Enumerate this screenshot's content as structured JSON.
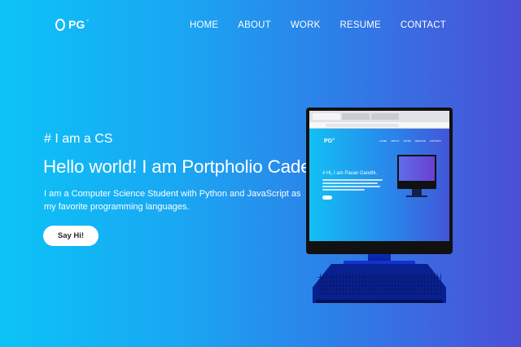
{
  "header": {
    "logo_text": "PG",
    "logo_mark": "°",
    "nav": [
      "HOME",
      "ABOUT",
      "WORK",
      "RESUME",
      "CONTACT"
    ]
  },
  "hero": {
    "eyebrow": "# I am a CS",
    "headline": "Hello world! I am Portpholio Caden",
    "lead": "I am a Computer Science Student with Python and JavaScript as my favorite programming languages.",
    "cta_label": "Say Hi!"
  },
  "illustration": {
    "screen_logo": "PG°",
    "screen_nav": [
      "HOME",
      "ABOUT",
      "WORK",
      "RESUME",
      "CONTACT"
    ],
    "screen_title": "# Hi, I am Pavan Gandhi."
  },
  "colors": {
    "gradient_start": "#0cc3f7",
    "gradient_end": "#4b4fd6",
    "button_bg": "#ffffff"
  }
}
